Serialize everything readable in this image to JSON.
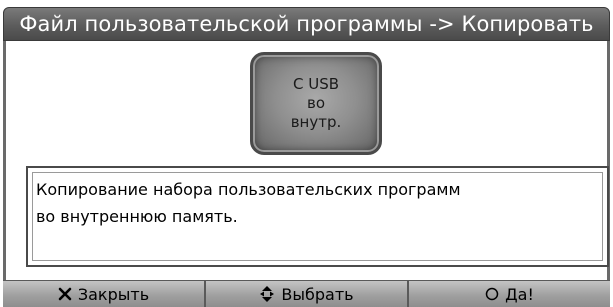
{
  "dialog": {
    "title": "Файл пользовательской программы -> Копировать"
  },
  "usb_button": {
    "line1": "C USB",
    "line2": "во",
    "line3": "внутр."
  },
  "description": {
    "line1": "Копирование набора пользовательских программ",
    "line2": "во внутреннюю память."
  },
  "bottom_bar": {
    "close_label": "Закрыть",
    "close_icon": "x-icon",
    "select_label": "Выбрать",
    "select_icon": "updown-arrows-icon",
    "ok_label": "Да!",
    "ok_icon": "circle-icon"
  }
}
